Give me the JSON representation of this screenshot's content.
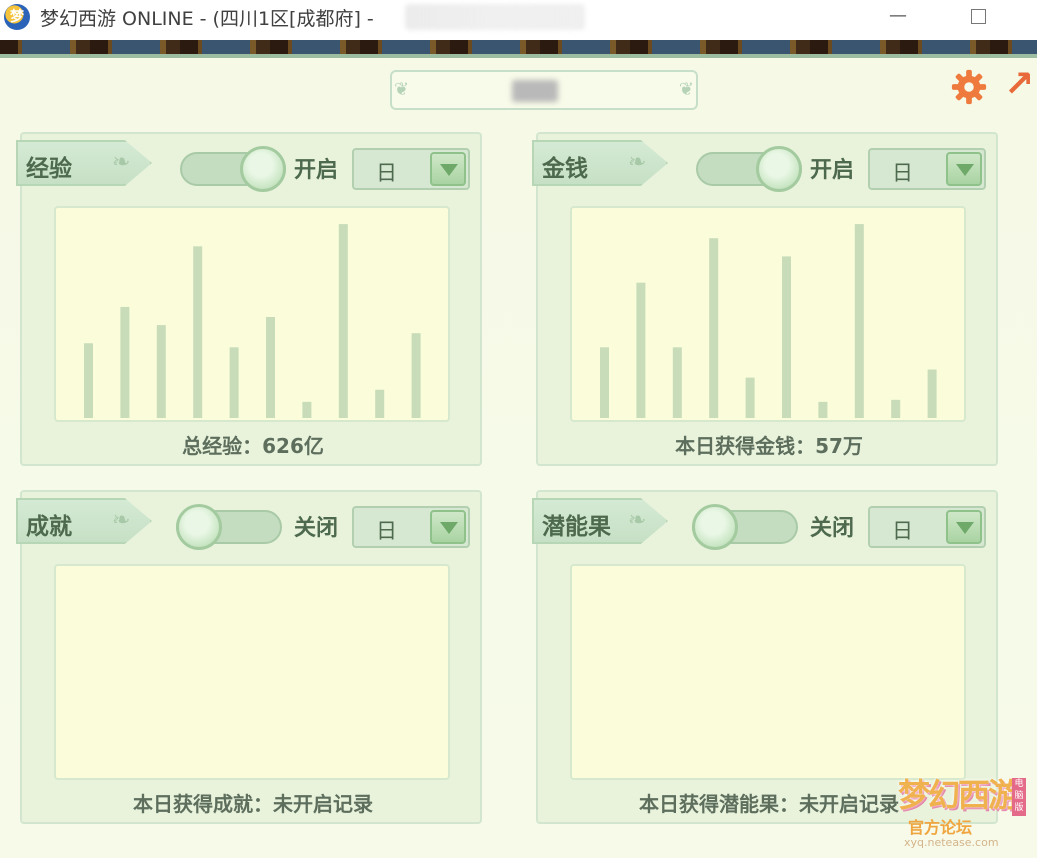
{
  "window": {
    "title": "梦幻西游 ONLINE - (四川1区[成都府] -",
    "icon": "app-logo-icon",
    "minimize_icon": "minimize-icon",
    "maximize_icon": "maximize-icon"
  },
  "header": {
    "settings_icon": "gear-icon",
    "expand_icon": "expand-arrow-icon"
  },
  "panels": [
    {
      "id": "exp",
      "label": "经验",
      "toggle_on": true,
      "toggle_label": "开启",
      "period": "日",
      "caption": "总经验：626亿",
      "bars": [
        0.37,
        0.55,
        0.46,
        0.85,
        0.35,
        0.5,
        0.08,
        0.96,
        0.14,
        0.42
      ]
    },
    {
      "id": "money",
      "label": "金钱",
      "toggle_on": true,
      "toggle_label": "开启",
      "period": "日",
      "caption": "本日获得金钱：57万",
      "bars": [
        0.35,
        0.67,
        0.35,
        0.89,
        0.2,
        0.8,
        0.08,
        0.96,
        0.09,
        0.24
      ]
    },
    {
      "id": "achieve",
      "label": "成就",
      "toggle_on": false,
      "toggle_label": "关闭",
      "period": "日",
      "caption": "本日获得成就：未开启记录",
      "bars": []
    },
    {
      "id": "potential",
      "label": "潜能果",
      "toggle_on": false,
      "toggle_label": "关闭",
      "period": "日",
      "caption": "本日获得潜能果：未开启记录",
      "bars": []
    }
  ],
  "watermark": {
    "logo": "梦幻西游",
    "sub": "官方论坛",
    "url": "xyq.netease.com",
    "tag": "电脑版"
  },
  "colors": {
    "bar": "#c8dcb9",
    "accent": "#e86a3a"
  }
}
